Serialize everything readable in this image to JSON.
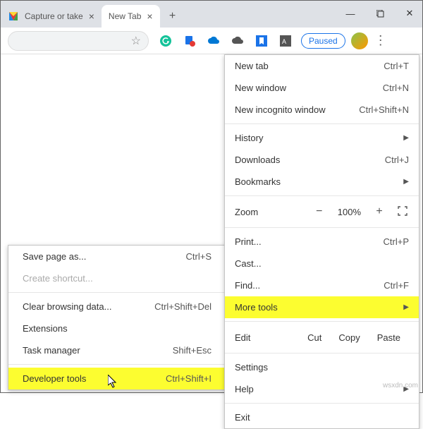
{
  "tabs": [
    {
      "title": "Capture or take",
      "active": false
    },
    {
      "title": "New Tab",
      "active": true
    }
  ],
  "window": {
    "min": "—",
    "max": "□",
    "close": "✕",
    "newtab": "+"
  },
  "toolbar": {
    "star": "☆",
    "paused": "Paused",
    "kebab": "⋮"
  },
  "menu": {
    "newTab": {
      "label": "New tab",
      "shortcut": "Ctrl+T"
    },
    "newWindow": {
      "label": "New window",
      "shortcut": "Ctrl+N"
    },
    "incognito": {
      "label": "New incognito window",
      "shortcut": "Ctrl+Shift+N"
    },
    "history": {
      "label": "History"
    },
    "downloads": {
      "label": "Downloads",
      "shortcut": "Ctrl+J"
    },
    "bookmarks": {
      "label": "Bookmarks"
    },
    "zoom": {
      "label": "Zoom",
      "out": "−",
      "value": "100%",
      "in": "+"
    },
    "print": {
      "label": "Print...",
      "shortcut": "Ctrl+P"
    },
    "cast": {
      "label": "Cast..."
    },
    "find": {
      "label": "Find...",
      "shortcut": "Ctrl+F"
    },
    "moreTools": {
      "label": "More tools"
    },
    "editRow": {
      "label": "Edit",
      "cut": "Cut",
      "copy": "Copy",
      "paste": "Paste"
    },
    "settings": {
      "label": "Settings"
    },
    "help": {
      "label": "Help"
    },
    "exit": {
      "label": "Exit"
    }
  },
  "submenu": {
    "savePage": {
      "label": "Save page as...",
      "shortcut": "Ctrl+S"
    },
    "createShortcut": {
      "label": "Create shortcut..."
    },
    "clearData": {
      "label": "Clear browsing data...",
      "shortcut": "Ctrl+Shift+Del"
    },
    "extensions": {
      "label": "Extensions"
    },
    "taskManager": {
      "label": "Task manager",
      "shortcut": "Shift+Esc"
    },
    "devTools": {
      "label": "Developer tools",
      "shortcut": "Ctrl+Shift+I"
    }
  },
  "watermark": "wsxdn.com"
}
